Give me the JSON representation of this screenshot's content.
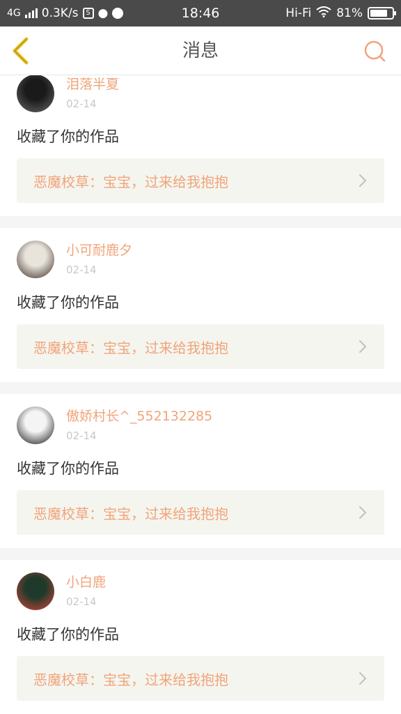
{
  "status_bar": {
    "network": "4G",
    "speed": "0.3K/s",
    "time": "18:46",
    "wifi_label": "Hi-Fi",
    "battery": "81%",
    "battery_level": 0.81
  },
  "header": {
    "title": "消息",
    "back_icon": "chevron-left-icon",
    "search_icon": "search-icon"
  },
  "messages": [
    {
      "username": "泪落半夏",
      "date": "02-14",
      "action": "收藏了你的作品",
      "work_title": "恶魔校草：宝宝，过来给我抱抱",
      "avatar_colors": [
        "#1a1a1a",
        "#6a6a6a"
      ]
    },
    {
      "username": "小可耐鹿夕",
      "date": "02-14",
      "action": "收藏了你的作品",
      "work_title": "恶魔校草：宝宝，过来给我抱抱",
      "avatar_colors": [
        "#e8e4dc",
        "#3a2a22"
      ]
    },
    {
      "username": "傲娇村长^_552132285",
      "date": "02-14",
      "action": "收藏了你的作品",
      "work_title": "恶魔校草：宝宝，过来给我抱抱",
      "avatar_colors": [
        "#f4f4f4",
        "#111111"
      ]
    },
    {
      "username": "小白鹿",
      "date": "02-14",
      "action": "收藏了你的作品",
      "work_title": "恶魔校草：宝宝，过来给我抱抱",
      "avatar_colors": [
        "#1f3a2a",
        "#d8453a"
      ]
    }
  ],
  "colors": {
    "accent": "#f0a47a",
    "back_arrow": "#e8c020",
    "card_link_bg": "#f5f5ef",
    "page_bg": "#f5f5f5"
  }
}
